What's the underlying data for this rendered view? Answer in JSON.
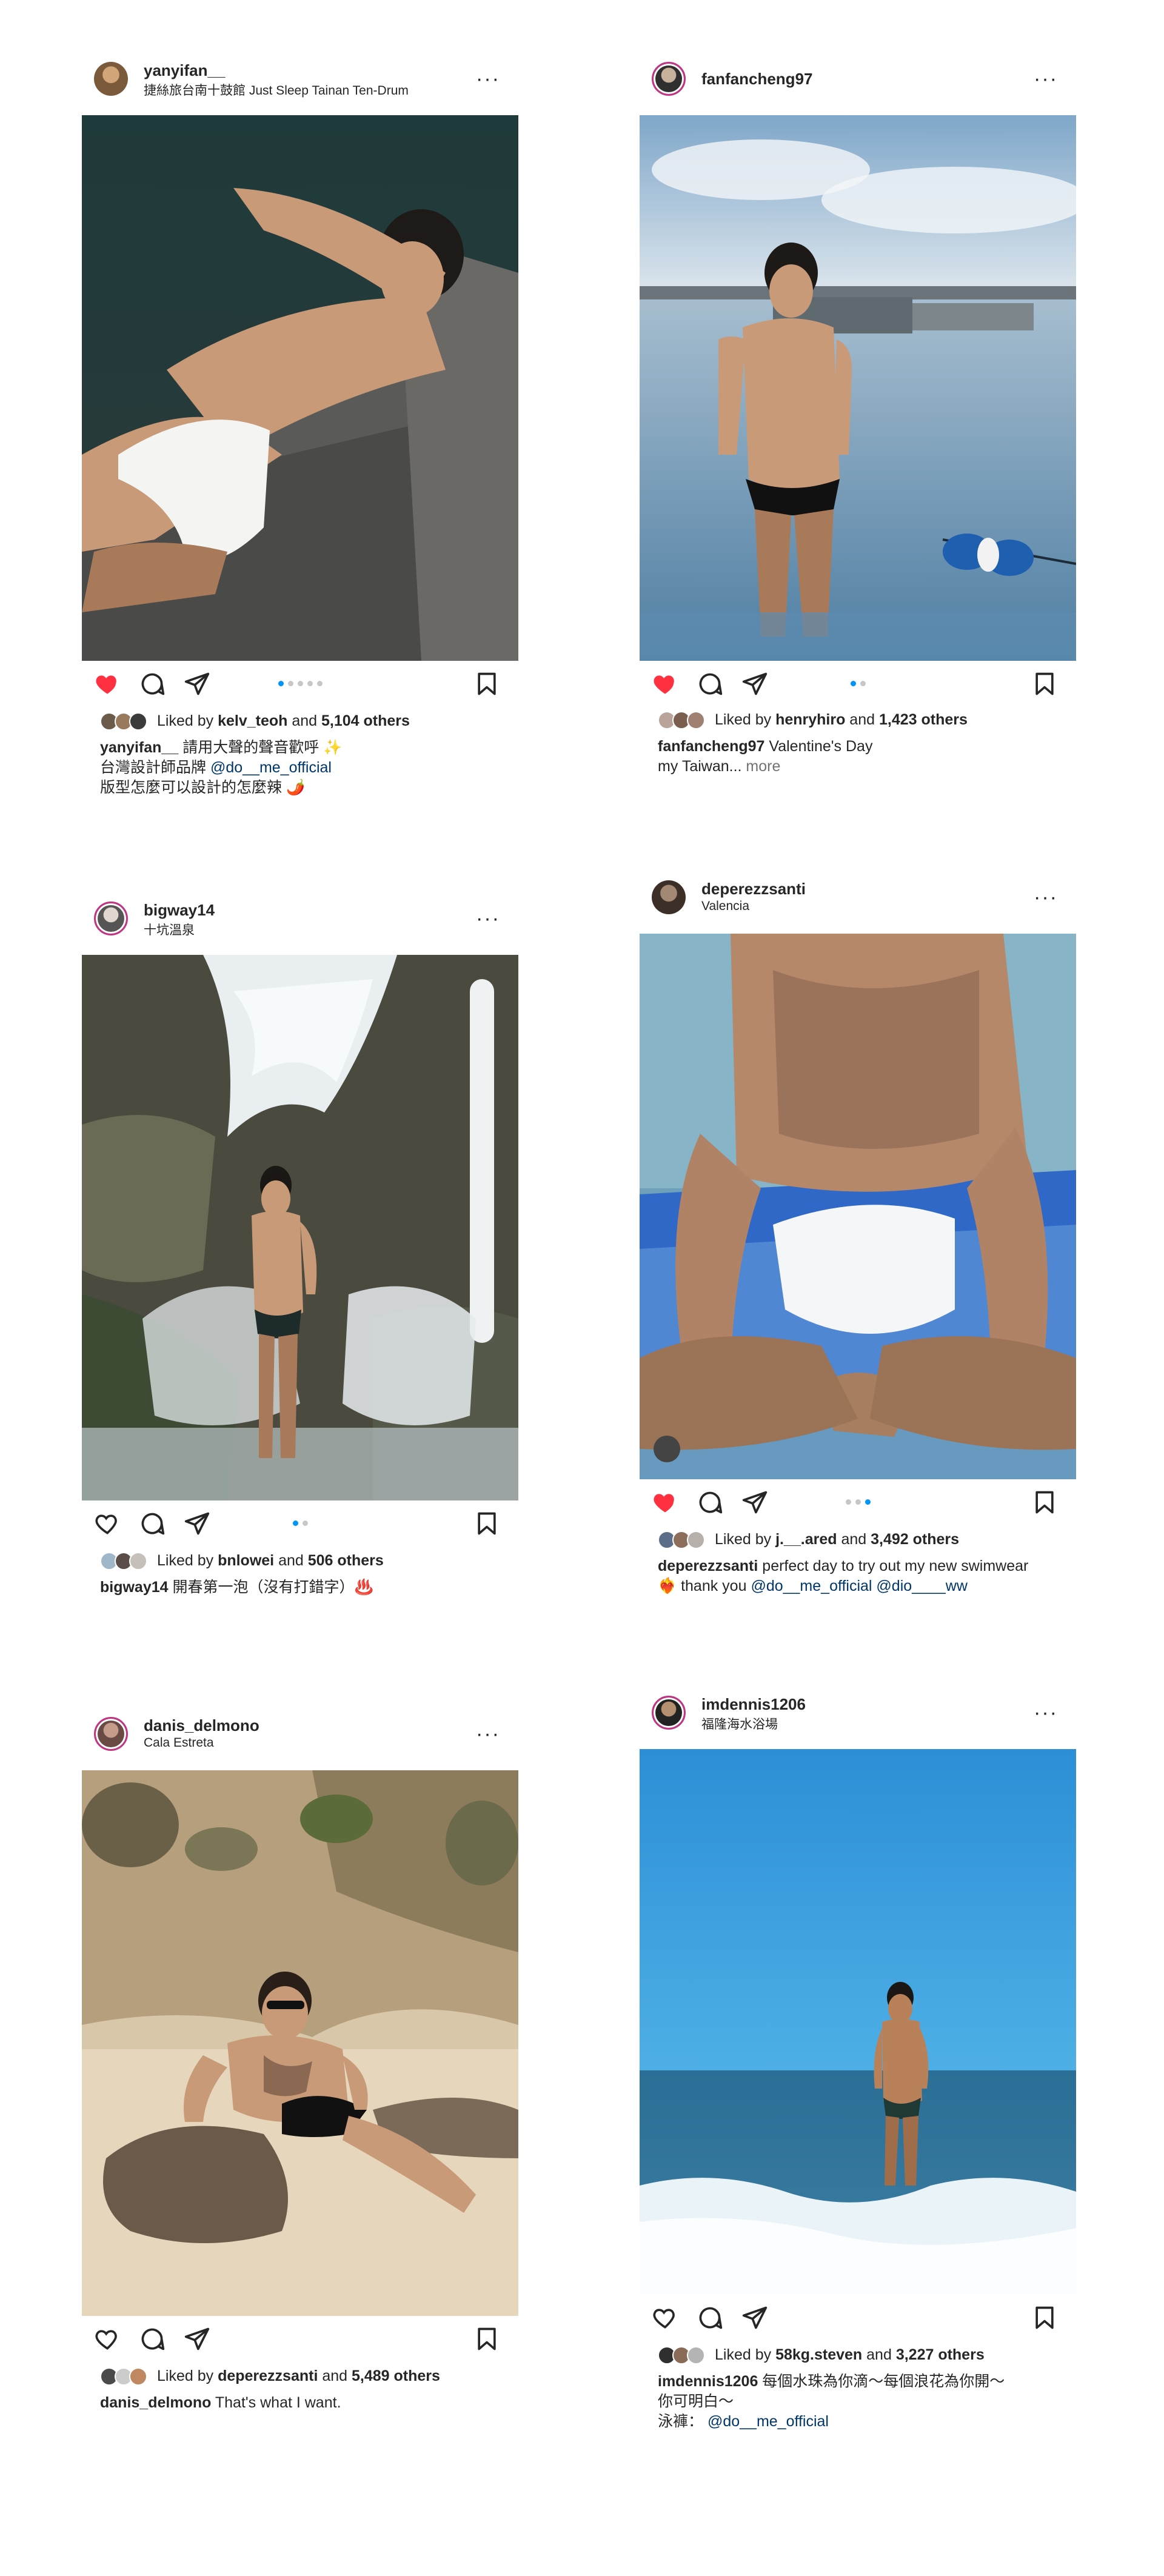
{
  "posts": [
    {
      "username": "yanyifan__",
      "location": "捷絲旅台南十鼓館 Just Sleep Tainan Ten-Drum",
      "liked": true,
      "carousel_count": 5,
      "carousel_active": 0,
      "liked_by": "kelv_teoh",
      "liked_others": "5,104 others",
      "caption_lines": [
        {
          "author": "yanyifan__",
          "text": " 請用大聲的聲音歡呼 ✨"
        },
        {
          "author": "",
          "text": "台灣設計師品牌 ",
          "mention": "@do__me_official"
        },
        {
          "author": "",
          "text": "版型怎麼可以設計的怎麼辣 🌶️"
        }
      ],
      "more_label": ""
    },
    {
      "username": "fanfancheng97",
      "location": "",
      "liked": true,
      "carousel_count": 2,
      "carousel_active": 0,
      "liked_by": "henryhiro",
      "liked_others": "1,423 others",
      "caption_lines": [
        {
          "author": "fanfancheng97",
          "text": " Valentine's Day"
        },
        {
          "author": "",
          "text": "my Taiwan...",
          "more": " more"
        }
      ],
      "more_label": "more"
    },
    {
      "username": "bigway14",
      "location": "十坑溫泉",
      "liked": false,
      "carousel_count": 2,
      "carousel_active": 0,
      "liked_by": "bnlowei",
      "liked_others": "506 others",
      "caption_lines": [
        {
          "author": "bigway14",
          "text": " 開春第一泡（沒有打錯字）♨️"
        }
      ],
      "more_label": ""
    },
    {
      "username": "deperezzsanti",
      "location": "Valencia",
      "liked": true,
      "carousel_count": 3,
      "carousel_active": 2,
      "liked_by": "j.__.ared",
      "liked_others": "3,492 others",
      "caption_lines": [
        {
          "author": "deperezzsanti",
          "text": " perfect day to try out my new swimwear"
        },
        {
          "author": "",
          "text": "❤️‍🔥 thank you ",
          "mention": "@do__me_official @dio____ww"
        }
      ],
      "more_label": ""
    },
    {
      "username": "danis_delmono",
      "location": "Cala Estreta",
      "liked": false,
      "carousel_count": 0,
      "carousel_active": 0,
      "liked_by": "deperezzsanti",
      "liked_others": "5,489 others",
      "caption_lines": [
        {
          "author": "danis_delmono",
          "text": " That's what I want."
        }
      ],
      "more_label": ""
    },
    {
      "username": "imdennis1206",
      "location": "福隆海水浴場",
      "liked": false,
      "carousel_count": 0,
      "carousel_active": 0,
      "liked_by": "58kg.steven",
      "liked_others": "3,227 others",
      "caption_lines": [
        {
          "author": "imdennis1206",
          "text": " 每個水珠為你滴～每個浪花為你開～"
        },
        {
          "author": "",
          "text": "你可明白～"
        },
        {
          "author": "",
          "text": "泳褲： ",
          "mention": "@do__me_official"
        }
      ],
      "more_label": ""
    }
  ],
  "ui": {
    "liked_by_prefix": "Liked by ",
    "and_word": " and ",
    "more_dots": "···"
  },
  "colors": {
    "heart_liked": "#ff3040",
    "mention": "#00376b",
    "carousel_active": "#0095f6",
    "carousel_inactive": "#c7c7c7"
  }
}
